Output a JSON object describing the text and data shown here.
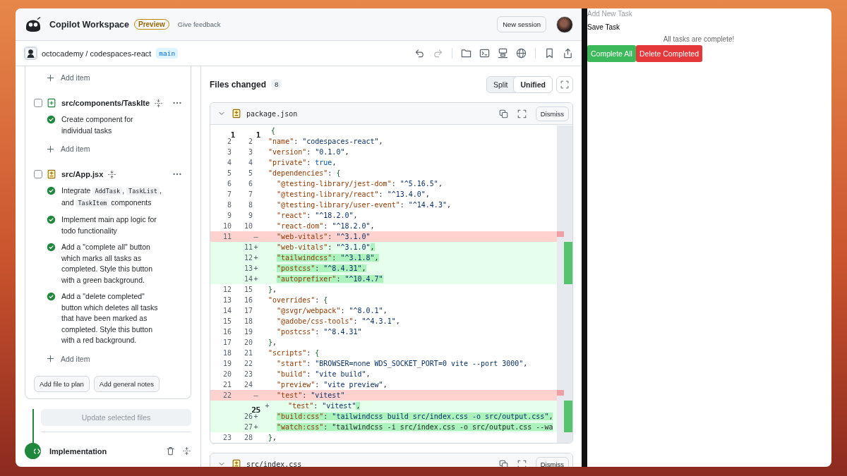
{
  "header": {
    "title": "Copilot Workspace",
    "badge": "Preview",
    "feedback_link": "Give feedback",
    "new_session_button": "New session"
  },
  "repo_bar": {
    "repo": "octocademy / codespaces-react",
    "branch": "main",
    "toolbar_groups": [
      [
        {
          "kind": "undo",
          "disabled": false
        },
        {
          "kind": "redo",
          "disabled": true
        }
      ],
      [
        {
          "kind": "folder",
          "disabled": false
        },
        {
          "kind": "terminal",
          "disabled": false
        },
        {
          "kind": "server",
          "disabled": false
        },
        {
          "kind": "globe",
          "disabled": false
        }
      ],
      [
        {
          "kind": "bookmark",
          "disabled": false
        },
        {
          "kind": "share",
          "disabled": false
        }
      ]
    ]
  },
  "plan": {
    "items": [
      {
        "kind": "add_item",
        "label": "Add item"
      },
      {
        "kind": "file",
        "checked": false,
        "icon": {
          "kind": "added"
        },
        "path": "src/components/TaskIte",
        "steps": [
          {
            "done": true,
            "parts": [
              {
                "text": "Create component for individual tasks"
              }
            ]
          }
        ]
      },
      {
        "kind": "add_item",
        "label": "Add item"
      },
      {
        "kind": "file",
        "checked": false,
        "icon": {
          "kind": "modified"
        },
        "path": "src/App.jsx",
        "steps": [
          {
            "done": true,
            "parts": [
              {
                "text": "Integrate "
              },
              {
                "code": "AddTask"
              },
              {
                "text": ", "
              },
              {
                "code": "TaskList"
              },
              {
                "text": ", and "
              },
              {
                "code": "TaskItem"
              },
              {
                "text": " components"
              }
            ]
          },
          {
            "done": true,
            "parts": [
              {
                "text": "Implement main app logic for todo functionality"
              }
            ]
          },
          {
            "done": true,
            "parts": [
              {
                "text": "Add a \"complete all\" button which marks all tasks as completed. Style this button with a green background."
              }
            ]
          },
          {
            "done": true,
            "parts": [
              {
                "text": "Add a \"delete completed\" button which deletes all tasks that have been marked as completed. Style this button with a red background."
              }
            ]
          }
        ]
      },
      {
        "kind": "add_item",
        "label": "Add item"
      }
    ],
    "buttons": [
      "Add file to plan",
      "Add general notes"
    ],
    "update_button": {
      "label": "Update selected files",
      "disabled": true
    },
    "next_step": {
      "title": "Implementation"
    }
  },
  "diff": {
    "title": "Files changed",
    "count": "8",
    "views": [
      {
        "label": "Split",
        "selected": false
      },
      {
        "label": "Unified",
        "selected": true
      }
    ],
    "files": [
      {
        "name": "package.json",
        "icon": {
          "kind": "modified"
        },
        "dismiss": "Dismiss",
        "lines": [
          {
            "kind": "context",
            "old": "1",
            "new": "1",
            "active": true,
            "text": "{"
          },
          {
            "kind": "context",
            "old": "2",
            "new": "2",
            "active": false,
            "text": "  \"name\": \"codespaces-react\","
          },
          {
            "kind": "context",
            "old": "3",
            "new": "3",
            "active": false,
            "text": "  \"version\": \"0.1.0\","
          },
          {
            "kind": "context",
            "old": "4",
            "new": "4",
            "active": false,
            "text": "  \"private\": true,"
          },
          {
            "kind": "context",
            "old": "5",
            "new": "5",
            "active": false,
            "text": "  \"dependencies\": {"
          },
          {
            "kind": "context",
            "old": "6",
            "new": "6",
            "active": false,
            "text": "    \"@testing-library/jest-dom\": \"^5.16.5\","
          },
          {
            "kind": "context",
            "old": "7",
            "new": "7",
            "active": false,
            "text": "    \"@testing-library/react\": \"^13.4.0\","
          },
          {
            "kind": "context",
            "old": "8",
            "new": "8",
            "active": false,
            "text": "    \"@testing-library/user-event\": \"^14.4.3\","
          },
          {
            "kind": "context",
            "old": "9",
            "new": "9",
            "active": false,
            "text": "    \"react\": \"^18.2.0\","
          },
          {
            "kind": "context",
            "old": "10",
            "new": "10",
            "active": false,
            "text": "    \"react-dom\": \"^18.2.0\","
          },
          {
            "kind": "removed",
            "old": "11",
            "sign": "–",
            "active": false,
            "text": "    \"web-vitals\": \"^3.1.0\""
          },
          {
            "kind": "added",
            "new": "11",
            "sign": "+",
            "active": false,
            "text": "    \"web-vitals\": \"^3.1.0\"",
            "changed": ","
          },
          {
            "kind": "added",
            "new": "12",
            "sign": "+",
            "active": false,
            "changed": "\"tailwindcss\": \"^3.1.8\","
          },
          {
            "kind": "added",
            "new": "13",
            "sign": "+",
            "active": false,
            "changed": "\"postcss\": \"^8.4.31\","
          },
          {
            "kind": "added",
            "new": "14",
            "sign": "+",
            "active": false,
            "changed": "\"autoprefixer\": \"^10.4.7\""
          },
          {
            "kind": "context",
            "old": "12",
            "new": "15",
            "active": false,
            "text": "  },"
          },
          {
            "kind": "context",
            "old": "13",
            "new": "16",
            "active": false,
            "text": "  \"overrides\": {"
          },
          {
            "kind": "context",
            "old": "14",
            "new": "17",
            "active": false,
            "text": "    \"@svgr/webpack\": \"^8.0.1\","
          },
          {
            "kind": "context",
            "old": "15",
            "new": "18",
            "active": false,
            "text": "    \"@adobe/css-tools\": \"^4.3.1\","
          },
          {
            "kind": "context",
            "old": "16",
            "new": "19",
            "active": false,
            "text": "    \"postcss\": \"^8.4.31\""
          },
          {
            "kind": "context",
            "old": "17",
            "new": "20",
            "active": false,
            "text": "  },"
          },
          {
            "kind": "context",
            "old": "18",
            "new": "21",
            "active": false,
            "text": "  \"scripts\": {"
          },
          {
            "kind": "context",
            "old": "19",
            "new": "22",
            "active": false,
            "text": "    \"start\": \"BROWSER=none WDS_SOCKET_PORT=0 vite --port 3000\","
          },
          {
            "kind": "context",
            "old": "20",
            "new": "23",
            "active": false,
            "text": "    \"build\": \"vite build\","
          },
          {
            "kind": "context",
            "old": "21",
            "new": "24",
            "active": false,
            "text": "    \"preview\": \"vite preview\","
          },
          {
            "kind": "removed",
            "old": "22",
            "sign": "–",
            "active": false,
            "text": "    \"test\": \"vitest\""
          },
          {
            "kind": "added",
            "new": "25",
            "sign": "+",
            "active": true,
            "text": "    \"test\": \"vitest\"",
            "changed": ","
          },
          {
            "kind": "added",
            "new": "26",
            "sign": "+",
            "active": false,
            "changed": "\"build:css\": \"tailwindcss build src/index.css -o src/output.css\","
          },
          {
            "kind": "added",
            "new": "27",
            "sign": "+",
            "active": false,
            "changed": "\"watch:css\": \"tailwindcss -i src/index.css -o src/output.css --wa"
          },
          {
            "kind": "context",
            "old": "23",
            "new": "28",
            "active": false,
            "text": "  },"
          }
        ]
      },
      {
        "name": "src/index.css",
        "icon": {
          "kind": "modified"
        },
        "dismiss": "Dismiss"
      }
    ]
  },
  "preview": {
    "input": {
      "placeholder": "Add New Task"
    },
    "save_button": "Save Task",
    "message": "All tasks are complete!",
    "actions": [
      {
        "kind": "complete",
        "label": "Complete All"
      },
      {
        "kind": "delete",
        "label": "Delete Completed"
      }
    ]
  }
}
